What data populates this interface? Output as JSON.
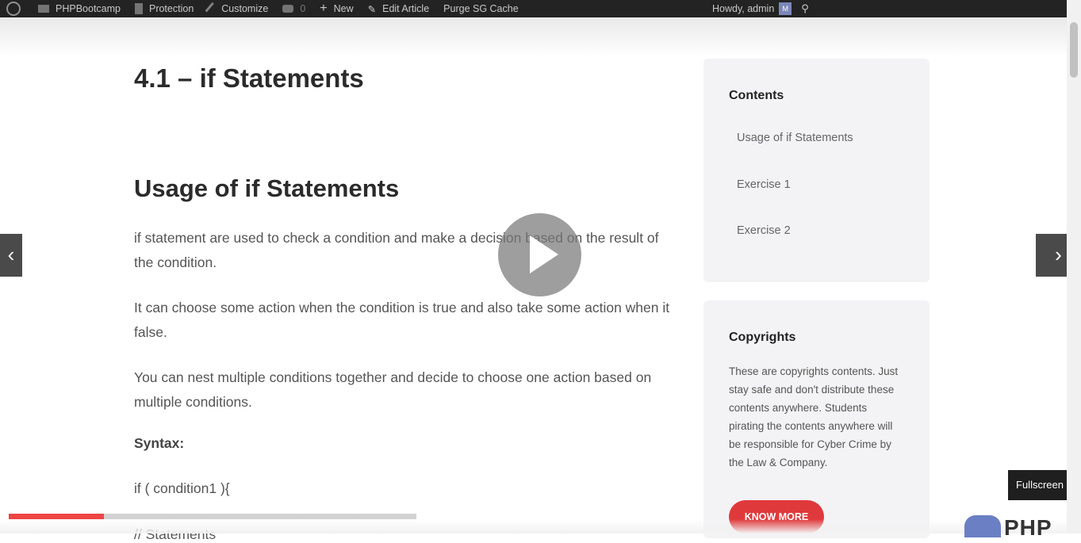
{
  "adminbar": {
    "site": "PHPBootcamp",
    "protection": "Protection",
    "customize": "Customize",
    "comments_count": "0",
    "new": "New",
    "edit": "Edit Article",
    "purge": "Purge SG Cache",
    "greeting": "Howdy, admin",
    "avatar_initial": "M"
  },
  "article": {
    "title": "4.1 – if Statements",
    "heading": "Usage of if Statements",
    "paragraphs": [
      "if statement are used to check a condition and make a decision based on the result of the condition.",
      "It can choose some action when the condition is true and also take some action when it false.",
      "You can nest multiple conditions together and decide to choose one action based on multiple conditions."
    ],
    "syntax_label": "Syntax:",
    "code_line1": "if ( condition1 ){",
    "code_line2": "// Statements"
  },
  "sidebar": {
    "contents_title": "Contents",
    "toc": [
      "Usage of if Statements",
      "Exercise 1",
      "Exercise 2"
    ],
    "copyright_title": "Copyrights",
    "copyright_text": "These are copyrights contents. Just stay safe and don't distribute these contents anywhere. Students pirating the contents anywhere will be responsible for Cyber Crime by the Law & Company.",
    "know_more": "KNOW MORE"
  },
  "video": {
    "fullscreen_label": "Fullscreen",
    "prev_glyph": "‹",
    "next_glyph": "›",
    "progress_fraction": 0.233,
    "logo_text": "PHP"
  },
  "colors": {
    "accent": "#e0393b",
    "adminbar": "#232323",
    "card": "#f3f3f5"
  }
}
